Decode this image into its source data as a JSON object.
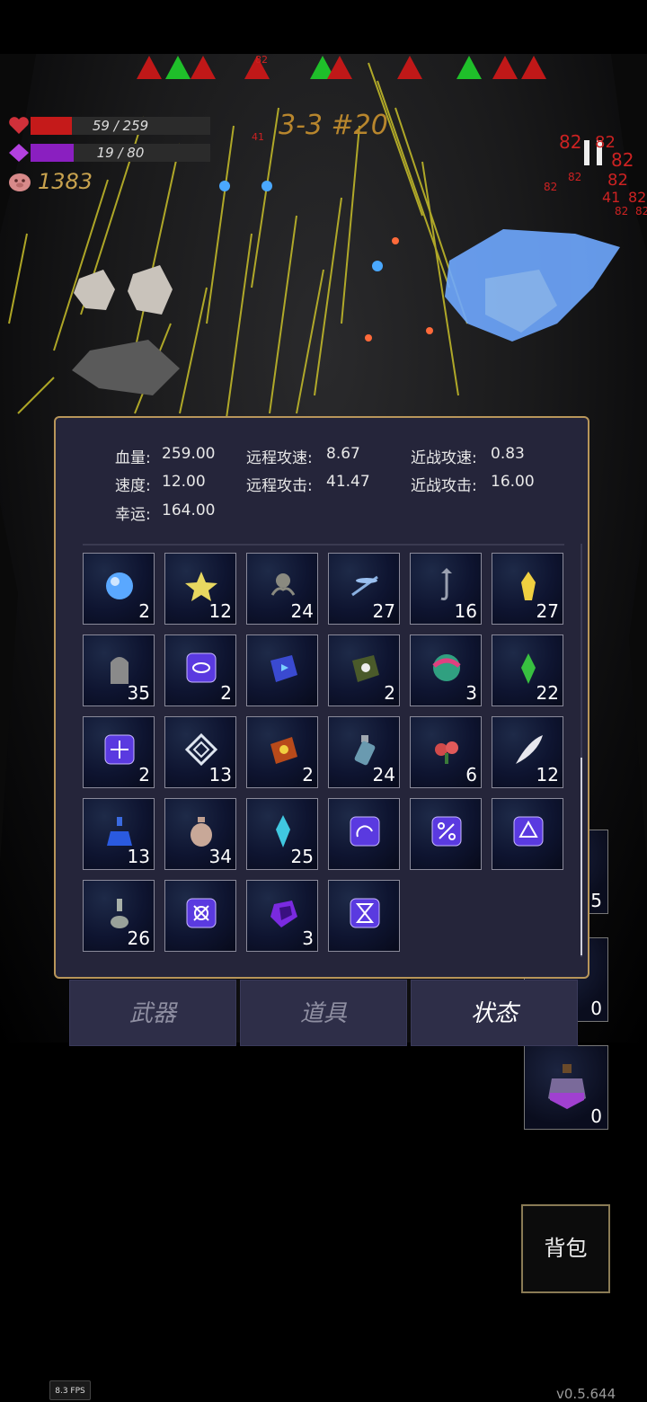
{
  "hud": {
    "hp_text": "59 / 259",
    "hp_fraction": 0.23,
    "mp_text": "19 / 80",
    "mp_fraction": 0.24,
    "gold": "1383",
    "wave": "3-3 #20",
    "damage_numbers": [
      "82",
      "82",
      "82",
      "82",
      "82",
      "82",
      "41",
      "82",
      "82",
      "82",
      "41",
      "82"
    ]
  },
  "colors": {
    "hp": "#c51a1a",
    "mp": "#8a1fc0",
    "gold": "#c8a24e",
    "panel_border": "#b8965a"
  },
  "stats": {
    "hp_label": "血量:",
    "hp_value": "259.00",
    "ranged_speed_label": "远程攻速:",
    "ranged_speed_value": "8.67",
    "melee_speed_label": "近战攻速:",
    "melee_speed_value": "0.83",
    "speed_label": "速度:",
    "speed_value": "12.00",
    "ranged_atk_label": "远程攻击:",
    "ranged_atk_value": "41.47",
    "melee_atk_label": "近战攻击:",
    "melee_atk_value": "16.00",
    "luck_label": "幸运:",
    "luck_value": "164.00"
  },
  "items": [
    {
      "icon": "blue-orb-icon",
      "count": "2"
    },
    {
      "icon": "star-cluster-icon",
      "count": "12"
    },
    {
      "icon": "octopus-icon",
      "count": "24"
    },
    {
      "icon": "dragonfly-icon",
      "count": "27"
    },
    {
      "icon": "hook-icon",
      "count": "16"
    },
    {
      "icon": "yellow-crystal-icon",
      "count": "27"
    },
    {
      "icon": "tombstone-icon",
      "count": "35"
    },
    {
      "icon": "rune-eye-icon",
      "count": "2"
    },
    {
      "icon": "blue-book-icon",
      "count": ""
    },
    {
      "icon": "skull-book-icon",
      "count": "2"
    },
    {
      "icon": "rainbow-orb-icon",
      "count": "3"
    },
    {
      "icon": "green-crystal-icon",
      "count": "22"
    },
    {
      "icon": "rune-cross-icon",
      "count": "2"
    },
    {
      "icon": "diamond-frame-icon",
      "count": "13"
    },
    {
      "icon": "sun-book-icon",
      "count": "2"
    },
    {
      "icon": "bottle-icon",
      "count": "24"
    },
    {
      "icon": "flower-icon",
      "count": "6"
    },
    {
      "icon": "feather-icon",
      "count": "12"
    },
    {
      "icon": "blue-potion-icon",
      "count": "13"
    },
    {
      "icon": "vase-icon",
      "count": "34"
    },
    {
      "icon": "cyan-crystal-icon",
      "count": "25"
    },
    {
      "icon": "rune-arc-icon",
      "count": ""
    },
    {
      "icon": "rune-percent-icon",
      "count": ""
    },
    {
      "icon": "rune-triangle-icon",
      "count": ""
    },
    {
      "icon": "grey-flask-icon",
      "count": "26"
    },
    {
      "icon": "rune-x-icon",
      "count": ""
    },
    {
      "icon": "purple-gem-icon",
      "count": "3"
    },
    {
      "icon": "rune-hourglass-icon",
      "count": ""
    }
  ],
  "tabs": [
    {
      "label": "武器"
    },
    {
      "label": "道具"
    },
    {
      "label": "状态"
    }
  ],
  "side_slots": [
    {
      "count": "5"
    },
    {
      "count": "0"
    },
    {
      "icon": "purple-potion-icon",
      "count": "0"
    }
  ],
  "bag_button": "背包",
  "fps": "8.3 FPS",
  "version": "v0.5.644"
}
